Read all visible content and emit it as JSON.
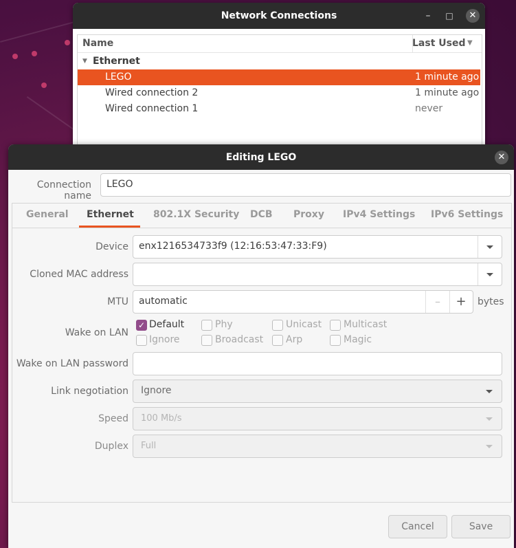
{
  "nc_window": {
    "title": "Network Connections",
    "columns": {
      "name": "Name",
      "last_used": "Last Used"
    },
    "group": "Ethernet",
    "connections": [
      {
        "name": "LEGO",
        "last_used": "1 minute ago"
      },
      {
        "name": "Wired connection 2",
        "last_used": "1 minute ago"
      },
      {
        "name": "Wired connection 1",
        "last_used": "never"
      }
    ]
  },
  "editor": {
    "title": "Editing LEGO",
    "connection_name_label": "Connection name",
    "connection_name_value": "LEGO",
    "tabs": [
      "General",
      "Ethernet",
      "802.1X Security",
      "DCB",
      "Proxy",
      "IPv4 Settings",
      "IPv6 Settings"
    ],
    "active_tab": "Ethernet",
    "device_label": "Device",
    "device_value": "enx1216534733f9 (12:16:53:47:33:F9)",
    "cloned_mac_label": "Cloned MAC address",
    "cloned_mac_value": "",
    "mtu_label": "MTU",
    "mtu_value": "automatic",
    "mtu_unit": "bytes",
    "wol_label": "Wake on LAN",
    "wol_options": [
      {
        "label": "Default",
        "checked": true
      },
      {
        "label": "Phy",
        "checked": false
      },
      {
        "label": "Unicast",
        "checked": false
      },
      {
        "label": "Multicast",
        "checked": false
      },
      {
        "label": "Ignore",
        "checked": false
      },
      {
        "label": "Broadcast",
        "checked": false
      },
      {
        "label": "Arp",
        "checked": false
      },
      {
        "label": "Magic",
        "checked": false
      }
    ],
    "wol_password_label": "Wake on LAN password",
    "wol_password_value": "",
    "link_negotiation_label": "Link negotiation",
    "link_negotiation_value": "Ignore",
    "speed_label": "Speed",
    "speed_value": "100 Mb/s",
    "duplex_label": "Duplex",
    "duplex_value": "Full",
    "cancel_label": "Cancel",
    "save_label": "Save"
  },
  "colors": {
    "accent": "#e95420",
    "checkbox": "#924d8b",
    "titlebar": "#2c2c2c"
  },
  "icons": {
    "minimize": "minimize-icon",
    "maximize": "maximize-icon",
    "close": "close-icon",
    "expander": "expander-down-icon"
  }
}
